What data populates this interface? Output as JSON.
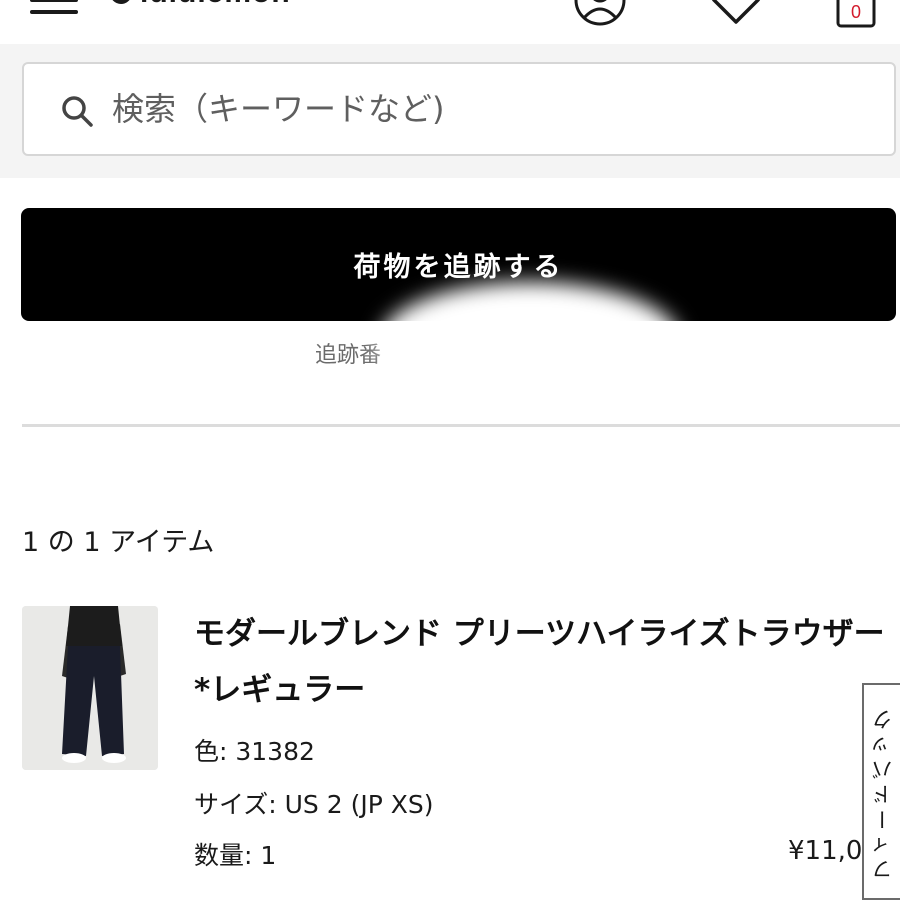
{
  "header": {
    "logo_text": "lululemon",
    "cart_count": "0",
    "icons": [
      "menu-icon",
      "lululemon-logo",
      "account-icon",
      "heart-icon",
      "shopping-bag-icon"
    ]
  },
  "search": {
    "placeholder": "検索（キーワードなど)"
  },
  "tracking": {
    "button_label": "荷物を追跡する",
    "number_label": "追跡番"
  },
  "items": {
    "count_text": "1 の 1 アイテム"
  },
  "product": {
    "name": "モダールブレンド プリーツハイライズトラウザー *レギュラー",
    "color_text": "色: 31382",
    "size_text": "サイズ: US 2 (JP XS)",
    "quantity_text": "数量: 1",
    "price_text": "¥11,0"
  },
  "feedback": {
    "label": "フィードバック"
  },
  "colors": {
    "primary_button": "#000000",
    "search_band": "#f4f4f4",
    "cart_count": "#d31b2c",
    "divider": "#dcdcdc"
  }
}
